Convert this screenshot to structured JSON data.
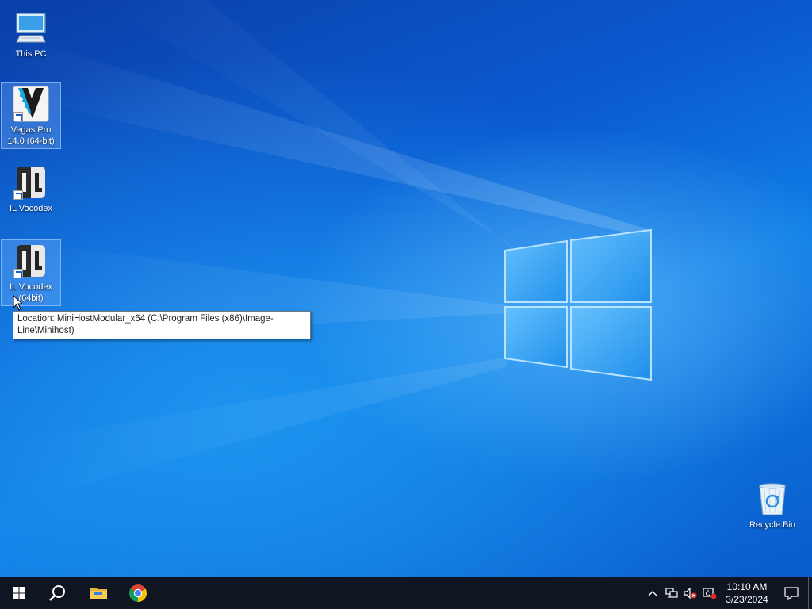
{
  "desktop": {
    "icons": [
      {
        "label": "This PC",
        "icon": "computer-icon"
      },
      {
        "label": "Vegas Pro 14.0 (64-bit)",
        "icon": "vegas-pro-icon"
      },
      {
        "label": "IL Vocodex",
        "icon": "il-vocodex-icon"
      },
      {
        "label": "IL Vocodex (64bit)",
        "icon": "il-vocodex-icon"
      },
      {
        "label": "Recycle Bin",
        "icon": "recycle-bin-icon"
      }
    ],
    "tooltip": "Location: MiniHostModular_x64 (C:\\Program Files (x86)\\Image-Line\\Minihost)"
  },
  "taskbar": {
    "start_icon": "windows-start-icon",
    "search_icon": "search-icon",
    "pinned": [
      {
        "name": "file-explorer-icon"
      },
      {
        "name": "chrome-icon"
      }
    ],
    "tray": {
      "chevron": "chevron-up-icon",
      "network": "network-icon",
      "volume": "volume-muted-icon",
      "power": "power-icon"
    },
    "clock": {
      "time": "10:10 AM",
      "date": "3/23/2024"
    },
    "notification_icon": "action-center-icon"
  },
  "colors": {
    "taskbar_bg": "#101522",
    "wallpaper_accent": "#0f7ee6"
  }
}
